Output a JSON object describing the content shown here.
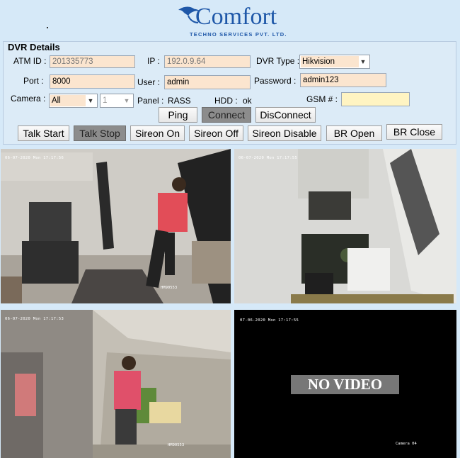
{
  "header": {
    "logo_text": "Comfort",
    "logo_subtext": "TECHNO SERVICES PVT. LTD."
  },
  "dvr": {
    "title": "DVR Details",
    "atm_label": "ATM ID :",
    "atm_value": "201335773",
    "ip_label": "IP :",
    "ip_value": "192.0.9.64",
    "dvr_type_label": "DVR Type :",
    "dvr_type_value": "Hikvision",
    "port_label": "Port :",
    "port_value": "8000",
    "user_label": "User :",
    "user_value": "admin",
    "password_label": "Password :",
    "password_value": "admin123",
    "camera_label": "Camera :",
    "camera_value": "All",
    "channel_value": "1",
    "panel_label": "Panel :",
    "panel_value": "RASS",
    "hdd_label": "HDD :",
    "hdd_value": "ok",
    "gsm_label": "GSM # :",
    "gsm_value": ""
  },
  "buttons": {
    "ping": "Ping",
    "connect": "Connect",
    "disconnect": "DisConnect",
    "talk_start": "Talk Start",
    "talk_stop": "Talk Stop",
    "sireon_on": "Sireon On",
    "sireon_off": "Sireon Off",
    "sireon_disable": "Sireon Disable",
    "br_open": "BR Open",
    "br_close": "BR Close"
  },
  "cameras": [
    {
      "timestamp": "06-07-2020 Mon 17:17:56",
      "label": "HM90553"
    },
    {
      "timestamp": "06-07-2020 Mon 17:17:55",
      "label": ""
    },
    {
      "timestamp": "06-07-2020 Mon 17:17:53",
      "label": "HM90553"
    },
    {
      "timestamp": "07-06-2020 Mon 17:17:55",
      "label": "Camera 04",
      "overlay": "NO VIDEO"
    }
  ],
  "colors": {
    "background": "#d6e9f8",
    "input_fill": "#fbe5cf",
    "gsm_fill": "#fff4c2",
    "brand_blue": "#1e57a8"
  }
}
